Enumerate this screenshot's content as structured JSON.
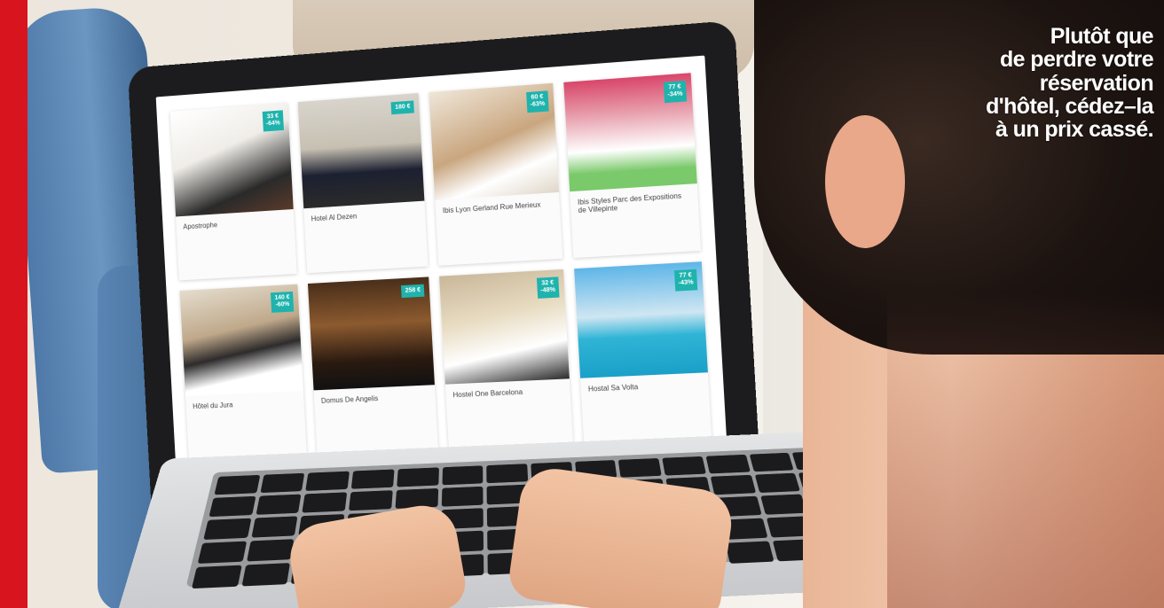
{
  "caption": {
    "text": "Plutôt que\nde perdre votre\nréservation\nd'hôtel, cédez–la\nà un prix cassé."
  },
  "colors": {
    "accent_bar": "#d8151f",
    "badge": "#1fb3ad",
    "caption_text": "#ffffff"
  },
  "screen": {
    "hotels": [
      {
        "name": "Apostrophe",
        "badge": "33 €\n-64%"
      },
      {
        "name": "Hotel Al Dezen",
        "badge": "180 €"
      },
      {
        "name": "Ibis Lyon Gerland Rue Merieux",
        "badge": "60 €\n-63%"
      },
      {
        "name": "Ibis Styles Parc des Expositions de Villepinte",
        "badge": "77 €\n-34%"
      },
      {
        "name": "Hôtel du Jura",
        "badge": "140 €\n-60%"
      },
      {
        "name": "Domus De Angelis",
        "badge": "258 €"
      },
      {
        "name": "Hostel One Barcelona",
        "badge": "32 €\n-48%"
      },
      {
        "name": "Hostal Sa Volta",
        "badge": "77 €\n-43%"
      }
    ]
  }
}
